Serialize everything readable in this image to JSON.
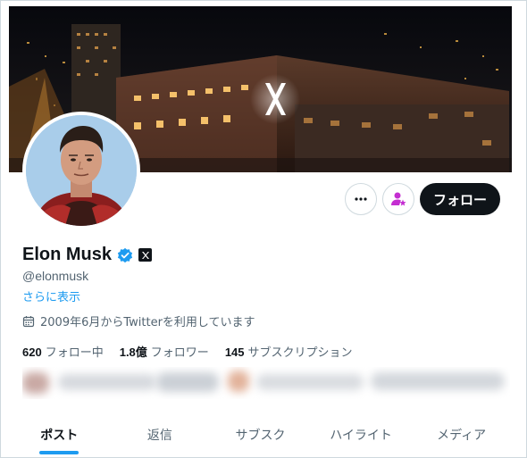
{
  "profile": {
    "display_name": "Elon Musk",
    "handle": "@elonmusk",
    "show_more": "さらに表示",
    "joined": "2009年6月からTwitterを利用しています"
  },
  "actions": {
    "more_icon": "more-horizontal-icon",
    "subscribe_icon": "subscribe-person-star-icon",
    "follow_label": "フォロー"
  },
  "stats": [
    {
      "count": "620",
      "label": "フォロー中"
    },
    {
      "count": "1.8億",
      "label": "フォロワー"
    },
    {
      "count": "145",
      "label": "サブスクリプション"
    }
  ],
  "tabs": [
    {
      "label": "ポスト",
      "active": true
    },
    {
      "label": "返信",
      "active": false
    },
    {
      "label": "サブスク",
      "active": false
    },
    {
      "label": "ハイライト",
      "active": false
    },
    {
      "label": "メディア",
      "active": false
    }
  ],
  "colors": {
    "accent": "#1d9bf0",
    "verified": "#1d9bf0",
    "follow_bg": "#0f1419",
    "subscribe_icon": "#c42ed1"
  }
}
